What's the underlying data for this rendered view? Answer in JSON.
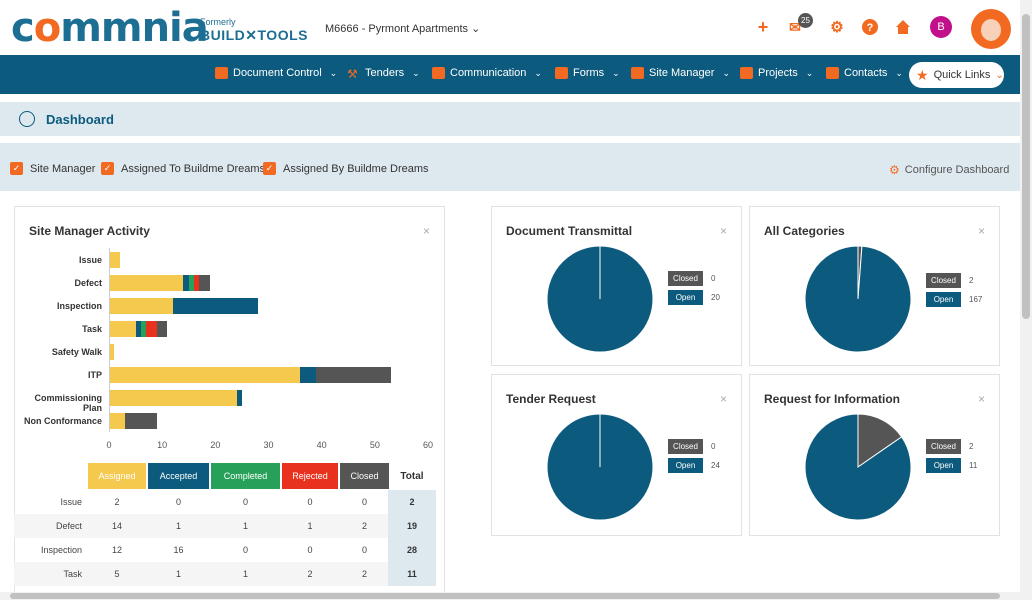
{
  "brand": {
    "logo_text_1": "c",
    "logo_text_2": "mmnia",
    "formerly": "Formerly",
    "build_tools": "BUILD✕TOOLS"
  },
  "project": {
    "selected": "M6666 - Pyrmont Apartments"
  },
  "header": {
    "badge_count": "25",
    "avatar_initial": "B"
  },
  "nav": {
    "items": [
      {
        "label": "Document Control"
      },
      {
        "label": "Tenders"
      },
      {
        "label": "Communication"
      },
      {
        "label": "Forms"
      },
      {
        "label": "Site Manager"
      },
      {
        "label": "Projects"
      },
      {
        "label": "Contacts"
      }
    ],
    "quick_links": "Quick Links"
  },
  "dashboard": {
    "title": "Dashboard",
    "configure": "Configure Dashboard"
  },
  "filters": [
    {
      "label": "Site Manager",
      "checked": true
    },
    {
      "label": "Assigned To Buildme Dreams",
      "checked": true
    },
    {
      "label": "Assigned By Buildme Dreams",
      "checked": true
    }
  ],
  "activity": {
    "title": "Site Manager Activity",
    "close": "×",
    "table_headers": [
      "Assigned",
      "Accepted",
      "Completed",
      "Rejected",
      "Closed"
    ],
    "total_header": "Total",
    "rows": [
      {
        "label": "Issue",
        "values": [
          "2",
          "0",
          "0",
          "0",
          "0"
        ],
        "total": "2"
      },
      {
        "label": "Defect",
        "values": [
          "14",
          "1",
          "1",
          "1",
          "2"
        ],
        "total": "19"
      },
      {
        "label": "Inspection",
        "values": [
          "12",
          "16",
          "0",
          "0",
          "0"
        ],
        "total": "28"
      },
      {
        "label": "Task",
        "values": [
          "5",
          "1",
          "1",
          "2",
          "2"
        ],
        "total": "11"
      }
    ]
  },
  "chart_data": [
    {
      "type": "bar",
      "title": "Site Manager Activity",
      "orientation": "horizontal",
      "stacked": true,
      "categories": [
        "Issue",
        "Defect",
        "Inspection",
        "Task",
        "Safety Walk",
        "ITP",
        "Commissioning Plan",
        "Non Conformance"
      ],
      "xlim": [
        0,
        60
      ],
      "xticks": [
        "0",
        "10",
        "20",
        "30",
        "40",
        "50",
        "60"
      ],
      "series": [
        {
          "name": "Assigned",
          "color": "#f5c94e",
          "values": [
            2,
            14,
            12,
            5,
            1,
            36,
            24,
            3
          ]
        },
        {
          "name": "Accepted",
          "color": "#0c5a7d",
          "values": [
            0,
            1,
            16,
            1,
            0,
            3,
            1,
            0
          ]
        },
        {
          "name": "Completed",
          "color": "#27a05a",
          "values": [
            0,
            1,
            0,
            1,
            0,
            0,
            0,
            0
          ]
        },
        {
          "name": "Rejected",
          "color": "#e8321d",
          "values": [
            0,
            1,
            0,
            2,
            0,
            0,
            0,
            0
          ]
        },
        {
          "name": "Closed",
          "color": "#555555",
          "values": [
            0,
            2,
            0,
            2,
            0,
            14,
            0,
            6
          ]
        }
      ]
    },
    {
      "type": "pie",
      "title": "Document Transmittal",
      "labels": [
        "Closed",
        "Open"
      ],
      "values": [
        0,
        20
      ],
      "colors": [
        "#555555",
        "#0c5a7d"
      ]
    },
    {
      "type": "pie",
      "title": "All Categories",
      "labels": [
        "Closed",
        "Open"
      ],
      "values": [
        2,
        167
      ],
      "colors": [
        "#555555",
        "#0c5a7d"
      ]
    },
    {
      "type": "pie",
      "title": "Tender Request",
      "labels": [
        "Closed",
        "Open"
      ],
      "values": [
        0,
        24
      ],
      "colors": [
        "#555555",
        "#0c5a7d"
      ]
    },
    {
      "type": "pie",
      "title": "Request for Information",
      "labels": [
        "Closed",
        "Open"
      ],
      "values": [
        2,
        11
      ],
      "colors": [
        "#555555",
        "#0c5a7d"
      ]
    }
  ],
  "pies": {
    "doc": {
      "title": "Document Transmittal",
      "closed_label": "Closed",
      "open_label": "Open",
      "closed": "0",
      "open": "20"
    },
    "allcat": {
      "title": "All Categories",
      "closed_label": "Closed",
      "open_label": "Open",
      "closed": "2",
      "open": "167"
    },
    "tender": {
      "title": "Tender Request",
      "closed_label": "Closed",
      "open_label": "Open",
      "closed": "0",
      "open": "24"
    },
    "rfi": {
      "title": "Request for Information",
      "closed_label": "Closed",
      "open_label": "Open",
      "closed": "2",
      "open": "11"
    },
    "close": "×"
  },
  "colors": {
    "brand_blue": "#0c5a7d",
    "brand_orange": "#f26a21",
    "assigned": "#f5c94e",
    "accepted": "#0c5a7d",
    "completed": "#27a05a",
    "rejected": "#e8321d",
    "closed": "#555555"
  }
}
